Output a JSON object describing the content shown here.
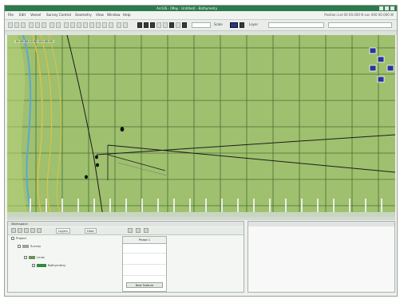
{
  "window": {
    "title": "ArcGIS - [Map : Untitled] - Bathymetry",
    "colors": {
      "titlebar": "#2c7a4d",
      "map_background": "#9fc06e",
      "grid": "#5f7f45",
      "track_line": "#1b1b1b",
      "shore_blue": "#5aa7d8",
      "shore_yellow": "#d8c24a"
    }
  },
  "menubar": {
    "items": [
      "File",
      "Edit",
      "Vessel",
      "Survey Control",
      "Geometry",
      "View",
      "Window",
      "Help"
    ],
    "right_label": "Position  Lat 00 00.000 N  Lon 000 00.000 W"
  },
  "toolbar": {
    "zoom_label": "Scale",
    "color_label": "Layer"
  },
  "map": {
    "coord_readout": "N: 45 34.12  W: 122 40.55",
    "icon_names": [
      "north-arrow-icon",
      "pan-up-icon",
      "pan-down-icon",
      "zoom-in-icon",
      "zoom-out-icon"
    ]
  },
  "bottom_left": {
    "title": "Workspace",
    "tabs": [
      "Layers",
      "Data"
    ],
    "tree": [
      {
        "label": "Project",
        "level": 0
      },
      {
        "label": "Survey",
        "level": 1
      },
      {
        "label": "Lines",
        "level": 2
      },
      {
        "label": "Bathymetry",
        "level": 3
      }
    ],
    "props_header": "Phase 1",
    "props_button": "New Feature"
  },
  "bottom_right": {
    "title": ""
  }
}
